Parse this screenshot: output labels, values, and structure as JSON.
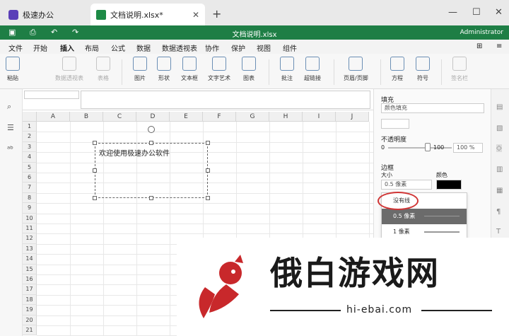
{
  "tabs": {
    "home": "极速办公",
    "doc": "文档说明.xlsx*",
    "close": "✕",
    "add": "+"
  },
  "window": {
    "minimize": "—",
    "maximize": "☐",
    "close": "✕"
  },
  "quickbar": {
    "title": "文档说明.xlsx",
    "user": "Administrator"
  },
  "menu": [
    "文件",
    "开始",
    "插入",
    "布局",
    "公式",
    "数据",
    "数据透视表",
    "协作",
    "保护",
    "视图",
    "组件"
  ],
  "active_menu": "插入",
  "ribbon": [
    {
      "label": "粘贴",
      "dim": false
    },
    {
      "label": "数据透视表",
      "dim": true
    },
    {
      "label": "表格",
      "dim": true
    },
    {
      "label": "图片",
      "dim": false
    },
    {
      "label": "形状",
      "dim": false
    },
    {
      "label": "文本框",
      "dim": false
    },
    {
      "label": "文字艺术",
      "dim": false
    },
    {
      "label": "图表",
      "dim": false
    },
    {
      "label": "批注",
      "dim": false
    },
    {
      "label": "超链接",
      "dim": false
    },
    {
      "label": "页眉/页脚",
      "dim": false
    },
    {
      "label": "方程",
      "dim": false
    },
    {
      "label": "符号",
      "dim": false
    },
    {
      "label": "签名栏",
      "dim": true
    }
  ],
  "formula": {
    "fx": "fx"
  },
  "columns": [
    "A",
    "B",
    "C",
    "D",
    "E",
    "F",
    "G",
    "H",
    "I",
    "J"
  ],
  "rows": [
    "1",
    "2",
    "3",
    "4",
    "5",
    "6",
    "7",
    "8",
    "9",
    "10",
    "11",
    "12",
    "13",
    "14",
    "15",
    "16",
    "17",
    "18",
    "19",
    "20",
    "21"
  ],
  "textbox": {
    "text": "欢迎使用极速办公软件"
  },
  "panel": {
    "fill_title": "填充",
    "fill_value": "颜色填充",
    "opacity_title": "不透明度",
    "opacity_min": "0",
    "opacity_max": "100",
    "opacity_value": "100 %",
    "border_title": "边框",
    "size_label": "大小",
    "color_label": "颜色",
    "size_value": "0.5 像素",
    "dropdown": [
      "没有线",
      "0.5 像素",
      "1 像素"
    ]
  },
  "colors": {
    "accent": "#1e7e45",
    "highlight": "#d03535"
  },
  "watermark": {
    "title": "俄白游戏网",
    "url": "hi-ebai.com"
  }
}
